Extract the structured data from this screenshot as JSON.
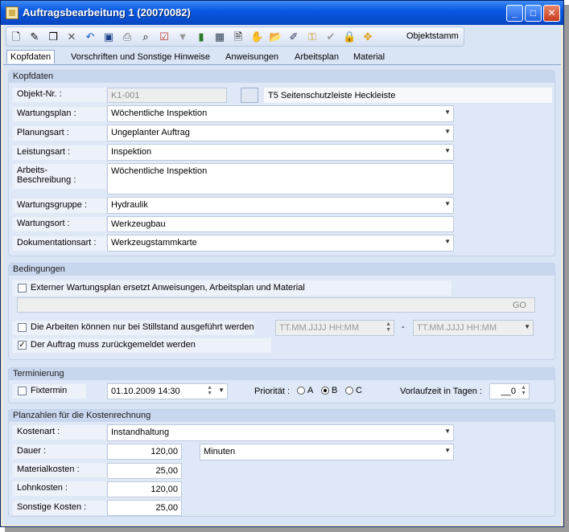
{
  "window": {
    "title": "Auftragsbearbeitung 1 (20070082)"
  },
  "toolbar": {
    "icons": [
      "new-icon",
      "edit-icon",
      "copy-icon",
      "delete-icon",
      "undo-icon",
      "save-icon",
      "print-icon",
      "preview-icon",
      "checklist-icon",
      "filter-icon",
      "book-icon",
      "calendar-icon",
      "document-icon",
      "hand-icon",
      "folder-open-icon",
      "pin-icon",
      "key-icon",
      "ok-icon",
      "lock-icon",
      "navigate-icon"
    ],
    "label": "Objektstamm"
  },
  "tabs": [
    "Kopfdaten",
    "Vorschriften und Sonstige Hinweise",
    "Anweisungen",
    "Arbeitsplan",
    "Material"
  ],
  "kopfdaten": {
    "heading": "Kopfdaten",
    "objekt_label": "Objekt-Nr. :",
    "objekt_value": "K1-001",
    "objekt_desc": "T5 Seitenschutzleiste Heckleiste",
    "wartungsplan_label": "Wartungsplan :",
    "wartungsplan_value": "Wöchentliche Inspektion",
    "planungsart_label": "Planungsart :",
    "planungsart_value": "Ungeplanter Auftrag",
    "leistungsart_label": "Leistungsart :",
    "leistungsart_value": "Inspektion",
    "beschreibung_label_1": "Arbeits-",
    "beschreibung_label_2": "Beschreibung :",
    "beschreibung_value": "Wöchentliche Inspektion",
    "wartungsgruppe_label": "Wartungsgruppe :",
    "wartungsgruppe_value": "Hydraulik",
    "wartungsort_label": "Wartungsort :",
    "wartungsort_value": "Werkzeugbau",
    "dokumentationsart_label": "Dokumentationsart :",
    "dokumentationsart_value": "Werkzeugstammkarte"
  },
  "bedingungen": {
    "heading": "Bedingungen",
    "extern_label": "Externer Wartungsplan ersetzt Anweisungen, Arbeitsplan und Material",
    "go_label": "GO",
    "stillstand_label": "Die Arbeiten können nur bei Stillstand ausgeführt werden",
    "date_from_placeholder": "TT.MM.JJJJ HH:MM",
    "date_sep": "-",
    "date_to_placeholder": "TT.MM.JJJJ HH:MM",
    "rueckmeldung_label": "Der Auftrag muss zurückgemeldet werden",
    "rueckmeldung_checked": true
  },
  "terminierung": {
    "heading": "Terminierung",
    "fixtermin_label": "Fixtermin",
    "date_value": "01.10.2009 14:30",
    "prioritaet_label": "Priorität :",
    "options": [
      "A",
      "B",
      "C"
    ],
    "selected": "B",
    "vorlaufzeit_label": "Vorlaufzeit in Tagen :",
    "vorlaufzeit_value": "__0"
  },
  "planzahlen": {
    "heading": "Planzahlen für die Kostenrechnung",
    "kostenart_label": "Kostenart :",
    "kostenart_value": "Instandhaltung",
    "dauer_label": "Dauer :",
    "dauer_value": "120,00",
    "dauer_unit": "Minuten",
    "material_label": "Materialkosten :",
    "material_value": "25,00",
    "lohn_label": "Lohnkosten :",
    "lohn_value": "120,00",
    "sonstige_label": "Sonstige Kosten :",
    "sonstige_value": "25,00"
  }
}
